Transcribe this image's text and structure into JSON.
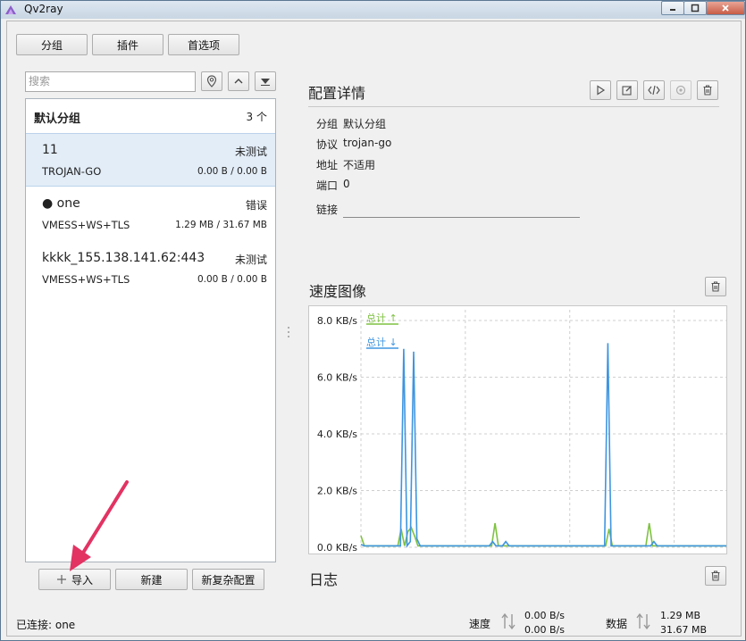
{
  "window": {
    "title": "Qv2ray"
  },
  "toolbar": {
    "groups": "分组",
    "plugins": "插件",
    "preferences": "首选项"
  },
  "search": {
    "placeholder": "搜索"
  },
  "group": {
    "name": "默认分组",
    "count": "3 个"
  },
  "connections": [
    {
      "name": "11",
      "status": "未测试",
      "protocol": "TROJAN-GO",
      "traffic": "0.00 B / 0.00 B",
      "selected": true
    },
    {
      "name": "● one",
      "status": "错误",
      "protocol": "VMESS+WS+TLS",
      "traffic": "1.29 MB / 31.67 MB",
      "selected": false
    },
    {
      "name": "kkkk_155.138.141.62:443",
      "status": "未测试",
      "protocol": "VMESS+WS+TLS",
      "traffic": "0.00 B / 0.00 B",
      "selected": false
    }
  ],
  "bottom_buttons": {
    "import": "导入",
    "new": "新建",
    "new_complex": "新复杂配置"
  },
  "details": {
    "title": "配置详情",
    "group_label": "分组",
    "group_value": "默认分组",
    "protocol_label": "协议",
    "protocol_value": "trojan-go",
    "address_label": "地址",
    "address_value": "不适用",
    "port_label": "端口",
    "port_value": "0",
    "link_label": "链接"
  },
  "speed": {
    "title": "速度图像"
  },
  "log": {
    "title": "日志"
  },
  "statusbar": {
    "connected": "已连接: one",
    "speed_label": "速度",
    "speed_up": "0.00 B/s",
    "speed_down": "0.00 B/s",
    "data_label": "数据",
    "data_up": "1.29 MB",
    "data_down": "31.67 MB"
  },
  "colors": {
    "upload": "#7fc241",
    "download": "#3f95e0",
    "accent": "#e23363"
  },
  "chart_data": {
    "type": "line",
    "ylim": [
      0,
      8
    ],
    "yticks": [
      "8.0 KB/s",
      "6.0 KB/s",
      "4.0 KB/s",
      "2.0 KB/s",
      "0.0 KB/s"
    ],
    "series": [
      {
        "name": "总计 ↑",
        "values": [
          0.4,
          0.05,
          0.05,
          0.05,
          0.05,
          0.05,
          0.05,
          0.05,
          0.05,
          0.05,
          0.05,
          0.05,
          0.65,
          0.05,
          0.55,
          0.7,
          0.4,
          0.05,
          0.05,
          0.05,
          0.05,
          0.05,
          0.05,
          0.05,
          0.05,
          0.05,
          0.05,
          0.05,
          0.05,
          0.05,
          0.05,
          0.05,
          0.05,
          0.05,
          0.05,
          0.05,
          0.05,
          0.05,
          0.05,
          0.05,
          0.85,
          0.05,
          0.05,
          0.05,
          0.05,
          0.05,
          0.05,
          0.05,
          0.05,
          0.05,
          0.05,
          0.05,
          0.05,
          0.05,
          0.05,
          0.05,
          0.05,
          0.05,
          0.05,
          0.05,
          0.05,
          0.05,
          0.05,
          0.05,
          0.05,
          0.05,
          0.05,
          0.05,
          0.05,
          0.05,
          0.05,
          0.05,
          0.05,
          0.05,
          0.65,
          0.05,
          0.05,
          0.05,
          0.05,
          0.05,
          0.05,
          0.05,
          0.05,
          0.05,
          0.05,
          0.05,
          0.85,
          0.05,
          0.05,
          0.05,
          0.05,
          0.05,
          0.05,
          0.05,
          0.05,
          0.05,
          0.05,
          0.05,
          0.05,
          0.05,
          0.05,
          0.05,
          0.05,
          0.05,
          0.05,
          0.05,
          0.05,
          0.05,
          0.05,
          0.05
        ]
      },
      {
        "name": "总计 ↓",
        "values": [
          0.1,
          0.05,
          0.05,
          0.05,
          0.05,
          0.05,
          0.05,
          0.05,
          0.05,
          0.05,
          0.05,
          0.05,
          0.05,
          7.0,
          0.05,
          0.2,
          6.9,
          0.3,
          0.05,
          0.05,
          0.05,
          0.05,
          0.05,
          0.05,
          0.05,
          0.05,
          0.05,
          0.05,
          0.05,
          0.05,
          0.05,
          0.05,
          0.05,
          0.05,
          0.05,
          0.05,
          0.05,
          0.05,
          0.05,
          0.05,
          0.2,
          0.05,
          0.05,
          0.05,
          0.2,
          0.05,
          0.05,
          0.05,
          0.05,
          0.05,
          0.05,
          0.05,
          0.05,
          0.05,
          0.05,
          0.05,
          0.05,
          0.05,
          0.05,
          0.05,
          0.05,
          0.05,
          0.05,
          0.05,
          0.05,
          0.05,
          0.05,
          0.05,
          0.05,
          0.05,
          0.05,
          0.05,
          0.05,
          0.05,
          0.05,
          7.2,
          0.05,
          0.05,
          0.05,
          0.05,
          0.05,
          0.05,
          0.05,
          0.05,
          0.05,
          0.05,
          0.05,
          0.05,
          0.05,
          0.2,
          0.05,
          0.05,
          0.05,
          0.05,
          0.05,
          0.05,
          0.05,
          0.05,
          0.05,
          0.05,
          0.05,
          0.05,
          0.05,
          0.05,
          0.05,
          0.05,
          0.05,
          0.05,
          0.05,
          0.05,
          0.05,
          0.05
        ]
      }
    ]
  }
}
